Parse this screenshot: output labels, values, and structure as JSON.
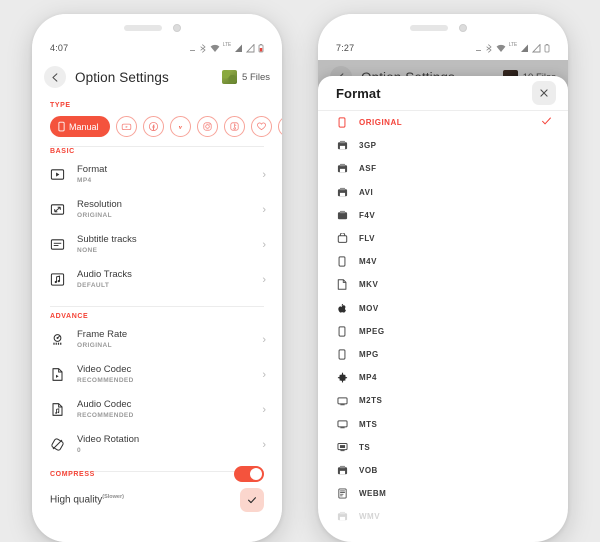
{
  "left_phone": {
    "status": {
      "time": "4:07",
      "network": "LTE"
    },
    "appbar": {
      "title": "Option Settings",
      "files_count": "5 Files",
      "back_icon": "arrow-left-icon"
    },
    "type_section": {
      "header": "TYPE",
      "chips": [
        {
          "label": "Manual",
          "icon": "phone-icon",
          "selected": true
        },
        {
          "label": "",
          "icon": "youtube-icon",
          "selected": false
        },
        {
          "label": "",
          "icon": "facebook-icon",
          "selected": false
        },
        {
          "label": "",
          "icon": "vimeo-icon",
          "selected": false
        },
        {
          "label": "",
          "icon": "instagram-icon",
          "selected": false
        },
        {
          "label": "",
          "icon": "tiktok-icon",
          "selected": false
        },
        {
          "label": "",
          "icon": "heart-icon",
          "selected": false
        },
        {
          "label": "",
          "icon": "more-icon",
          "selected": false
        }
      ]
    },
    "basic_section": {
      "header": "BASIC",
      "rows": [
        {
          "title": "Format",
          "value": "MP4",
          "icon": "video-play-icon"
        },
        {
          "title": "Resolution",
          "value": "ORIGINAL",
          "icon": "resize-icon"
        },
        {
          "title": "Subtitle tracks",
          "value": "NONE",
          "icon": "subtitle-icon"
        },
        {
          "title": "Audio Tracks",
          "value": "DEFAULT",
          "icon": "music-note-icon"
        }
      ]
    },
    "advance_section": {
      "header": "ADVANCE",
      "rows": [
        {
          "title": "Frame Rate",
          "value": "ORIGINAL",
          "icon": "speedometer-icon"
        },
        {
          "title": "Video Codec",
          "value": "RECOMMENDED",
          "icon": "file-video-icon"
        },
        {
          "title": "Audio Codec",
          "value": "RECOMMENDED",
          "icon": "file-audio-icon"
        },
        {
          "title": "Video Rotation",
          "value": "0",
          "icon": "rotate-icon"
        }
      ]
    },
    "compress_section": {
      "header": "COMPRESS",
      "toggle_on": true,
      "quality_label": "High quality",
      "quality_sup": "(Slower)",
      "checked": true
    }
  },
  "right_phone": {
    "status": {
      "time": "7:27",
      "network": "LTE"
    },
    "appbar": {
      "title": "Option Settings",
      "files_count": "10 Files",
      "back_icon": "arrow-left-icon"
    },
    "dialog": {
      "title": "Format",
      "close_icon": "close-icon",
      "options": [
        {
          "label": "ORIGINAL",
          "icon": "phone-icon",
          "selected": true
        },
        {
          "label": "3GP",
          "icon": "file-icon",
          "selected": false
        },
        {
          "label": "ASF",
          "icon": "file-icon",
          "selected": false
        },
        {
          "label": "AVI",
          "icon": "file-icon",
          "selected": false
        },
        {
          "label": "F4V",
          "icon": "file-icon",
          "selected": false
        },
        {
          "label": "FLV",
          "icon": "file-icon",
          "selected": false
        },
        {
          "label": "M4V",
          "icon": "phone-icon",
          "selected": false
        },
        {
          "label": "MKV",
          "icon": "document-icon",
          "selected": false
        },
        {
          "label": "MOV",
          "icon": "apple-icon",
          "selected": false
        },
        {
          "label": "MPEG",
          "icon": "phone-icon",
          "selected": false
        },
        {
          "label": "MPG",
          "icon": "phone-icon",
          "selected": false
        },
        {
          "label": "MP4",
          "icon": "android-icon",
          "selected": false
        },
        {
          "label": "M2TS",
          "icon": "tv-icon",
          "selected": false
        },
        {
          "label": "MTS",
          "icon": "tv-icon",
          "selected": false
        },
        {
          "label": "TS",
          "icon": "monitor-icon",
          "selected": false
        },
        {
          "label": "VOB",
          "icon": "file-icon",
          "selected": false
        },
        {
          "label": "WEBM",
          "icon": "web-icon",
          "selected": false
        },
        {
          "label": "WMV",
          "icon": "file-icon",
          "selected": false
        }
      ]
    }
  },
  "colors": {
    "accent": "#f4533d",
    "check": "#f4433a",
    "chip_border": "#f7a399",
    "toggle_on": "#f4533d"
  }
}
